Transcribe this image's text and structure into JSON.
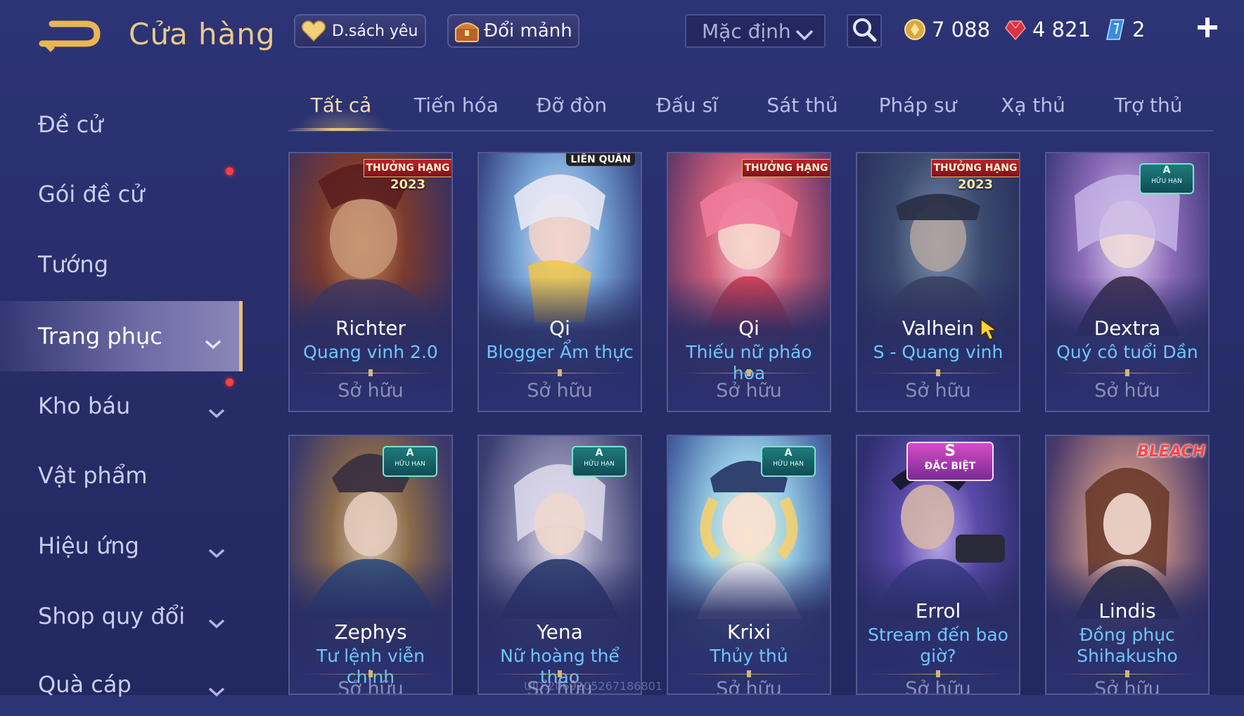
{
  "header": {
    "title": "Cửa hàng",
    "favorites_label": "D.sách yêu",
    "shards_label": "Đổi mảnh",
    "sort": {
      "selected": "Mặc định"
    },
    "currencies": [
      {
        "name": "gold-coin",
        "value": "7 088"
      },
      {
        "name": "ruby",
        "value": "4 821"
      },
      {
        "name": "gem",
        "value": "2"
      }
    ]
  },
  "sidebar": {
    "items": [
      {
        "label": "Đề cử"
      },
      {
        "label": "Gói đề cử"
      },
      {
        "label": "Tướng"
      },
      {
        "label": "Trang phục"
      },
      {
        "label": "Kho báu"
      },
      {
        "label": "Vật phẩm"
      },
      {
        "label": "Hiệu ứng"
      },
      {
        "label": "Shop quy đổi"
      },
      {
        "label": "Quà cáp"
      }
    ]
  },
  "tabs": [
    {
      "label": "Tất cả"
    },
    {
      "label": "Tiến hóa"
    },
    {
      "label": "Đỡ đòn"
    },
    {
      "label": "Đấu sĩ"
    },
    {
      "label": "Sát thủ"
    },
    {
      "label": "Pháp sư"
    },
    {
      "label": "Xạ thủ"
    },
    {
      "label": "Trợ thủ"
    }
  ],
  "cards": [
    {
      "hero": "Richter",
      "skin": "Quang vinh 2.0",
      "status": "Sở hữu",
      "badge": "THƯỞNG HẠNG",
      "badge_year": "2023",
      "accent": "#8a3a2c"
    },
    {
      "hero": "Qi",
      "skin": "Blogger Ẩm thực",
      "status": "Sở hữu",
      "badge": "LIÊN QUÂN",
      "accent": "#3a6aa0"
    },
    {
      "hero": "Qi",
      "skin": "Thiếu nữ pháo hoa",
      "status": "Sở hữu",
      "badge": "THƯỞNG HẠNG",
      "accent": "#a83a4c"
    },
    {
      "hero": "Valhein",
      "skin": "S - Quang vinh",
      "status": "Sở hữu",
      "badge": "THƯỞNG HẠNG",
      "badge_year": "2023",
      "accent": "#3c4a6e"
    },
    {
      "hero": "Dextra",
      "skin": "Quý cô tuổi Dần",
      "status": "Sở hữu",
      "badge_letter": "A",
      "badge_sub": "HỮU HẠN",
      "accent": "#5c4a8e"
    },
    {
      "hero": "Zephys",
      "skin": "Tư lệnh viễn chinh",
      "status": "Sở hữu",
      "badge_letter": "A",
      "badge_sub": "HỮU HẠN",
      "accent": "#6e5a3a"
    },
    {
      "hero": "Yena",
      "skin": "Nữ hoàng thể thao",
      "status": "Sở hữu",
      "badge_letter": "A",
      "badge_sub": "HỮU HẠN",
      "accent": "#4a5a7a"
    },
    {
      "hero": "Krixi",
      "skin": "Thủy thủ",
      "status": "Sở hữu",
      "badge_letter": "A",
      "badge_sub": "HỮU HẠN",
      "accent": "#4a8aa0"
    },
    {
      "hero": "Errol",
      "skin": "Stream đến bao giờ?",
      "status": "Sở hữu",
      "badge_letter": "S",
      "badge_sub": "ĐẶC BIỆT",
      "accent": "#4a3a8a"
    },
    {
      "hero": "Lindis",
      "skin": "Đồng phục Shihakusho",
      "status": "Sở hữu",
      "badge": "BLEACH",
      "accent": "#8a5a5a"
    }
  ],
  "watermark": "UID:2069205267186801",
  "colors": {
    "background": "#262c66",
    "title_gold": "#e9c98a",
    "skin_blue": "#6ec6ff",
    "active_bar": "#e6c27b",
    "notification_red": "#ff3e3e"
  }
}
